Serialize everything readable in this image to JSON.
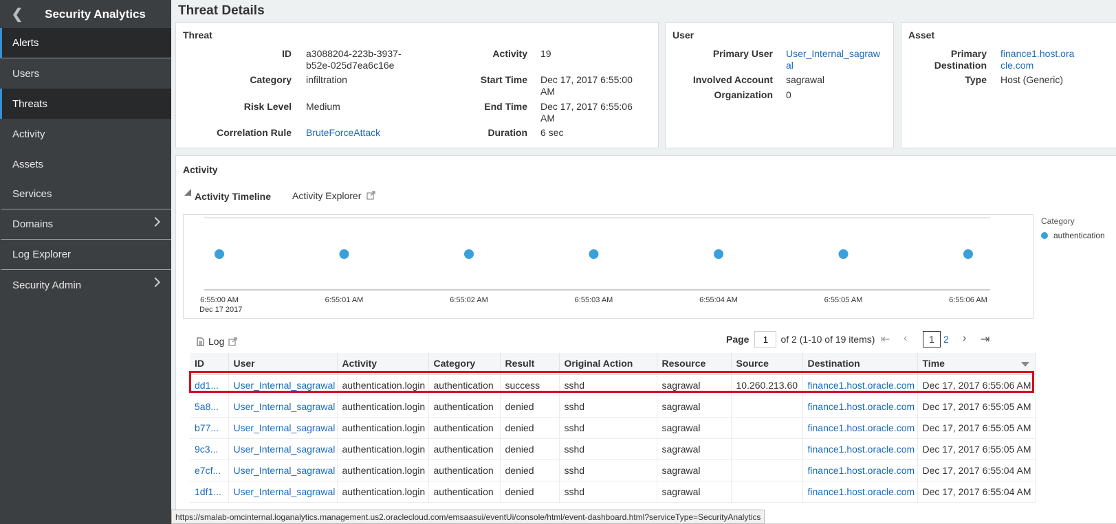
{
  "sidebar": {
    "title": "Security Analytics",
    "items": [
      {
        "label": "Alerts",
        "key": "alerts"
      },
      {
        "label": "Users",
        "key": "users"
      },
      {
        "label": "Threats",
        "key": "threats"
      },
      {
        "label": "Activity",
        "key": "activity"
      },
      {
        "label": "Assets",
        "key": "assets"
      },
      {
        "label": "Services",
        "key": "services"
      },
      {
        "label": "Domains",
        "key": "domains"
      },
      {
        "label": "Log Explorer",
        "key": "log-explorer"
      },
      {
        "label": "Security Admin",
        "key": "security-admin"
      }
    ]
  },
  "page_title": "Threat Details",
  "threat": {
    "title": "Threat",
    "id_label": "ID",
    "id_line1": "a3088204-223b-3937-",
    "id_line2": "b52e-025d7ea6c16e",
    "category_label": "Category",
    "category": "infiltration",
    "risk_label": "Risk Level",
    "risk": "Medium",
    "rule_label": "Correlation Rule",
    "rule": "BruteForceAttack",
    "activity_label": "Activity",
    "activity": "19",
    "start_label": "Start Time",
    "start_line1": "Dec 17, 2017 6:55:00",
    "start_line2": "AM",
    "end_label": "End Time",
    "end_line1": "Dec 17, 2017 6:55:06",
    "end_line2": "AM",
    "duration_label": "Duration",
    "duration": "6 sec"
  },
  "user": {
    "title": "User",
    "primary_label": "Primary User",
    "primary_line1": "User_Internal_sagraw",
    "primary_line2": "al",
    "account_label": "Involved Account",
    "account": "sagrawal",
    "org_label": "Organization",
    "org": "0"
  },
  "asset": {
    "title": "Asset",
    "dest_label_line1": "Primary",
    "dest_label_line2": "Destination",
    "dest_line1": "finance1.host.ora",
    "dest_line2": "cle.com",
    "type_label": "Type",
    "type": "Host (Generic)"
  },
  "activity": {
    "title": "Activity",
    "tab_timeline": "Activity Timeline",
    "tab_explorer": "Activity Explorer"
  },
  "chart_data": {
    "type": "scatter",
    "x": [
      "6:55:00 AM",
      "6:55:01 AM",
      "6:55:02 AM",
      "6:55:03 AM",
      "6:55:04 AM",
      "6:55:05 AM",
      "6:55:06 AM"
    ],
    "x_first_sublabel": "Dec 17 2017",
    "series": [
      {
        "name": "authentication",
        "values": [
          1,
          1,
          1,
          1,
          1,
          1,
          1
        ],
        "color": "#3aa0dc"
      }
    ],
    "legend_title": "Category",
    "legend_position": "right",
    "grid": false
  },
  "log": {
    "title": "Log",
    "page_label": "Page",
    "page_value": "1",
    "page_summary": "of 2 (1-10 of 19 items)",
    "current_page": "1",
    "next_page": "2",
    "columns": [
      "ID",
      "User",
      "Activity",
      "Category",
      "Result",
      "Original Action",
      "Resource",
      "Source",
      "Destination",
      "Time"
    ],
    "rows": [
      [
        "dd1...",
        "User_Internal_sagrawal",
        "authentication.login",
        "authentication",
        "success",
        "sshd",
        "sagrawal",
        "10.260.213.60",
        "finance1.host.oracle.com",
        "Dec 17, 2017 6:55:06 AM"
      ],
      [
        "5a8...",
        "User_Internal_sagrawal",
        "authentication.login",
        "authentication",
        "denied",
        "sshd",
        "sagrawal",
        "",
        "finance1.host.oracle.com",
        "Dec 17, 2017 6:55:05 AM"
      ],
      [
        "b77...",
        "User_Internal_sagrawal",
        "authentication.login",
        "authentication",
        "denied",
        "sshd",
        "sagrawal",
        "",
        "finance1.host.oracle.com",
        "Dec 17, 2017 6:55:05 AM"
      ],
      [
        "9c3...",
        "User_Internal_sagrawal",
        "authentication.login",
        "authentication",
        "denied",
        "sshd",
        "sagrawal",
        "",
        "finance1.host.oracle.com",
        "Dec 17, 2017 6:55:05 AM"
      ],
      [
        "e7cf...",
        "User_Internal_sagrawal",
        "authentication.login",
        "authentication",
        "denied",
        "sshd",
        "sagrawal",
        "",
        "finance1.host.oracle.com",
        "Dec 17, 2017 6:55:04 AM"
      ],
      [
        "1df1...",
        "User_Internal_sagrawal",
        "authentication.login",
        "authentication",
        "denied",
        "sshd",
        "sagrawal",
        "",
        "finance1.host.oracle.com",
        "Dec 17, 2017 6:55:04 AM"
      ]
    ]
  },
  "status_url": "https://smalab-omcinternal.loganalytics.management.us2.oraclecloud.com/emsaasui/eventUi/console/html/event-dashboard.html?serviceType=SecurityAnalytics"
}
